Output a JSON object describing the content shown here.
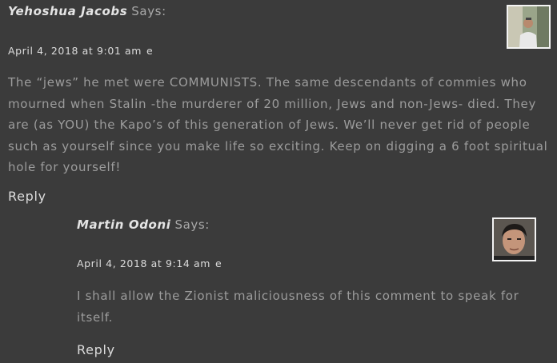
{
  "comments": [
    {
      "author": "Yehoshua Jacobs",
      "says": "Says:",
      "date": "April 4, 2018 at 9:01 am",
      "edit": "e",
      "avatar_icon": "user-photo-avatar",
      "body": "The “jews” he met were COMMUNISTS. The same descendants of commies who mourned when Stalin -the murderer of 20 million, Jews and non-Jews- died. They are (as YOU) the Kapo’s of this generation of Jews. We’ll never get rid of people such as yourself since you make life so exciting. Keep on digging a 6 foot spiritual hole for yourself!",
      "reply": "Reply"
    },
    {
      "author": "Martin Odoni",
      "says": "Says:",
      "date": "April 4, 2018 at 9:14 am",
      "edit": "e",
      "avatar_icon": "user-photo-avatar",
      "body": "I shall allow the Zionist maliciousness of this comment to speak for itself.",
      "reply": "Reply"
    }
  ],
  "colors": {
    "background": "#3b3b3b",
    "author": "#e4e4e4",
    "says": "#a9a9a9",
    "body": "#9c9c9c",
    "link": "#dcdcdc"
  }
}
